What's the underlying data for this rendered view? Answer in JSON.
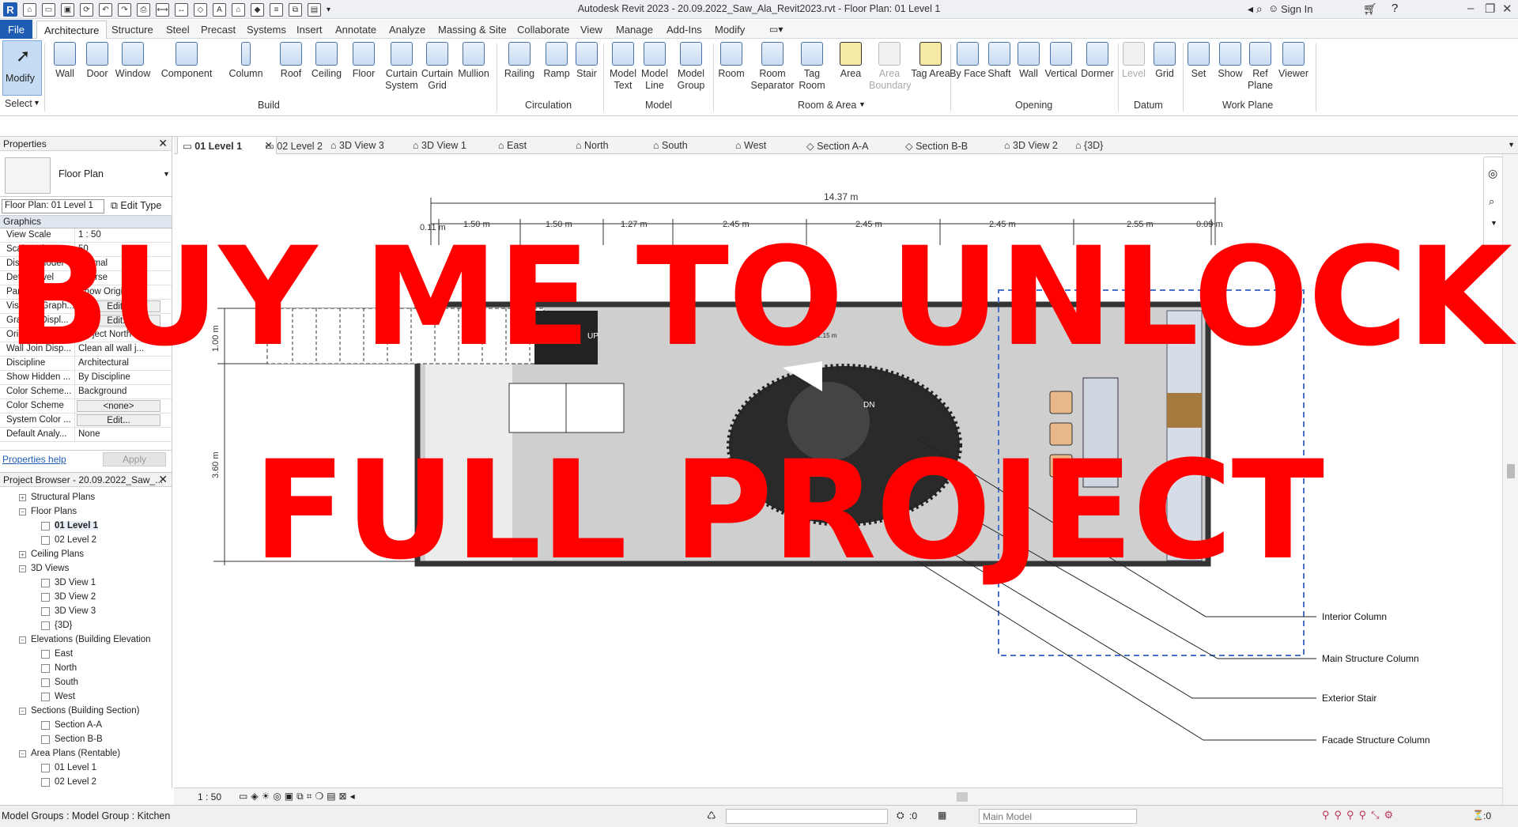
{
  "app": {
    "title": "Autodesk Revit 2023 - 20.09.2022_Saw_Ala_Revit2023.rvt - Floor Plan: 01 Level 1",
    "sign_in": "Sign In",
    "logo": "R"
  },
  "menu": {
    "file": "File",
    "tabs": [
      "Architecture",
      "Structure",
      "Steel",
      "Precast",
      "Systems",
      "Insert",
      "Annotate",
      "Analyze",
      "Massing & Site",
      "Collaborate",
      "View",
      "Manage",
      "Add-Ins",
      "Modify"
    ]
  },
  "ribbon": {
    "select": {
      "modify": "Modify",
      "panel": "Select"
    },
    "build": {
      "panel": "Build",
      "tools": [
        "Wall",
        "Door",
        "Window",
        "Component",
        "Column",
        "Roof",
        "Ceiling",
        "Floor",
        "Curtain System",
        "Curtain Grid",
        "Mullion"
      ]
    },
    "circulation": {
      "panel": "Circulation",
      "tools": [
        "Railing",
        "Ramp",
        "Stair"
      ]
    },
    "model": {
      "panel": "Model",
      "tools": [
        "Model Text",
        "Model Line",
        "Model Group"
      ]
    },
    "room": {
      "panel": "Room & Area",
      "tools": [
        "Room",
        "Room Separator",
        "Tag Room",
        "Area",
        "Area Boundary",
        "Tag Area"
      ]
    },
    "opening": {
      "panel": "Opening",
      "tools": [
        "By Face",
        "Shaft",
        "Wall",
        "Vertical",
        "Dormer"
      ]
    },
    "datum": {
      "panel": "Datum",
      "tools": [
        "Level",
        "Grid"
      ]
    },
    "workplane": {
      "panel": "Work Plane",
      "tools": [
        "Set",
        "Show",
        "Ref Plane",
        "Viewer"
      ]
    }
  },
  "properties": {
    "header": "Properties",
    "type_name": "Floor Plan",
    "instance": "Floor Plan: 01 Level 1",
    "edit_type": "Edit Type",
    "group": "Graphics",
    "rows": [
      {
        "k": "View Scale",
        "v": "1 : 50"
      },
      {
        "k": "Scale Value",
        "v": "50"
      },
      {
        "k": "Display Model",
        "v": "Normal"
      },
      {
        "k": "Detail Level",
        "v": "Coarse"
      },
      {
        "k": "Parts Visibility",
        "v": "Show Original"
      },
      {
        "k": "Visibility/Graph...",
        "v": "Edit..."
      },
      {
        "k": "Graphic Displ...",
        "v": "Edit..."
      },
      {
        "k": "Orientation",
        "v": "Project North"
      },
      {
        "k": "Wall Join Disp...",
        "v": "Clean all wall j..."
      },
      {
        "k": "Discipline",
        "v": "Architectural"
      },
      {
        "k": "Show Hidden ...",
        "v": "By Discipline"
      },
      {
        "k": "Color Scheme...",
        "v": "Background"
      },
      {
        "k": "Color Scheme",
        "v": "<none>"
      },
      {
        "k": "System Color ...",
        "v": "Edit..."
      },
      {
        "k": "Default Analy...",
        "v": "None"
      }
    ],
    "help": "Properties help",
    "apply": "Apply"
  },
  "browser": {
    "header": "Project Browser - 20.09.2022_Saw_...",
    "nodes": [
      {
        "label": "Structural Plans",
        "level": 1,
        "toggle": "+"
      },
      {
        "label": "Floor Plans",
        "level": 1,
        "toggle": "−"
      },
      {
        "label": "01 Level 1",
        "level": 2,
        "selected": true
      },
      {
        "label": "02 Level 2",
        "level": 2
      },
      {
        "label": "Ceiling Plans",
        "level": 1,
        "toggle": "+"
      },
      {
        "label": "3D Views",
        "level": 1,
        "toggle": "−"
      },
      {
        "label": "3D View 1",
        "level": 2
      },
      {
        "label": "3D View 2",
        "level": 2
      },
      {
        "label": "3D View 3",
        "level": 2
      },
      {
        "label": "{3D}",
        "level": 2
      },
      {
        "label": "Elevations (Building Elevation",
        "level": 1,
        "toggle": "−"
      },
      {
        "label": "East",
        "level": 2
      },
      {
        "label": "North",
        "level": 2
      },
      {
        "label": "South",
        "level": 2
      },
      {
        "label": "West",
        "level": 2
      },
      {
        "label": "Sections (Building Section)",
        "level": 1,
        "toggle": "−"
      },
      {
        "label": "Section A-A",
        "level": 2
      },
      {
        "label": "Section B-B",
        "level": 2
      },
      {
        "label": "Area Plans (Rentable)",
        "level": 1,
        "toggle": "−"
      },
      {
        "label": "01 Level 1",
        "level": 2
      },
      {
        "label": "02 Level 2",
        "level": 2
      }
    ]
  },
  "view_tabs": [
    "01 Level 1",
    "02 Level 2",
    "3D View 3",
    "3D View 1",
    "East",
    "North",
    "South",
    "West",
    "Section A-A",
    "Section B-B",
    "3D View 2",
    "{3D}"
  ],
  "drawing": {
    "overall_dim": "14.37 m",
    "dims": [
      "0.11 m",
      "1.50 m",
      "1.50 m",
      "1.27 m",
      "2.45 m",
      "2.45 m",
      "2.45 m",
      "2.55 m",
      "0.09 m"
    ],
    "left_dims": [
      "1.00 m",
      "3.60 m"
    ],
    "stair_up": "UP",
    "stair_dn": "DN",
    "small_dim": "2.15 m",
    "callouts": [
      "Interior Column",
      "Main Structure Column",
      "Exterior Stair",
      "Facade Structure Column"
    ]
  },
  "view_control": {
    "scale": "1 : 50"
  },
  "status": {
    "text": "Model Groups : Model Group : Kitchen",
    "workset": "Main Model",
    "count": ":0",
    "filter": ":0"
  },
  "watermark": {
    "line1": "BUY ME TO UNLOCK",
    "line2": "FULL PROJECT",
    "color": "#ff0000"
  }
}
